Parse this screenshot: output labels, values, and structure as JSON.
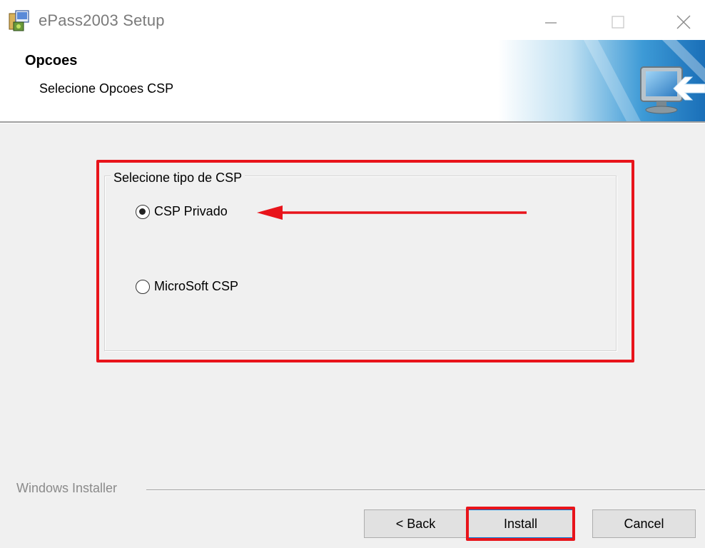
{
  "window": {
    "title": "ePass2003 Setup",
    "icon": "installer-icon",
    "controls": [
      "minimize-icon",
      "maximize-icon",
      "close-icon"
    ]
  },
  "banner": {
    "title": "Opcoes",
    "subtitle": "Selecione Opcoes CSP",
    "art_icon": "computer-arrow-icon"
  },
  "group": {
    "label": "Selecione tipo de CSP",
    "options": [
      {
        "label": "CSP Privado",
        "selected": true
      },
      {
        "label": "MicroSoft CSP",
        "selected": false
      }
    ]
  },
  "footer": {
    "installer_label": "Windows Installer"
  },
  "buttons": {
    "back": "< Back",
    "install": "Install",
    "cancel": "Cancel"
  },
  "annotation": {
    "highlight_color": "#e8141b",
    "arrow_icon": "left-arrow-icon"
  }
}
